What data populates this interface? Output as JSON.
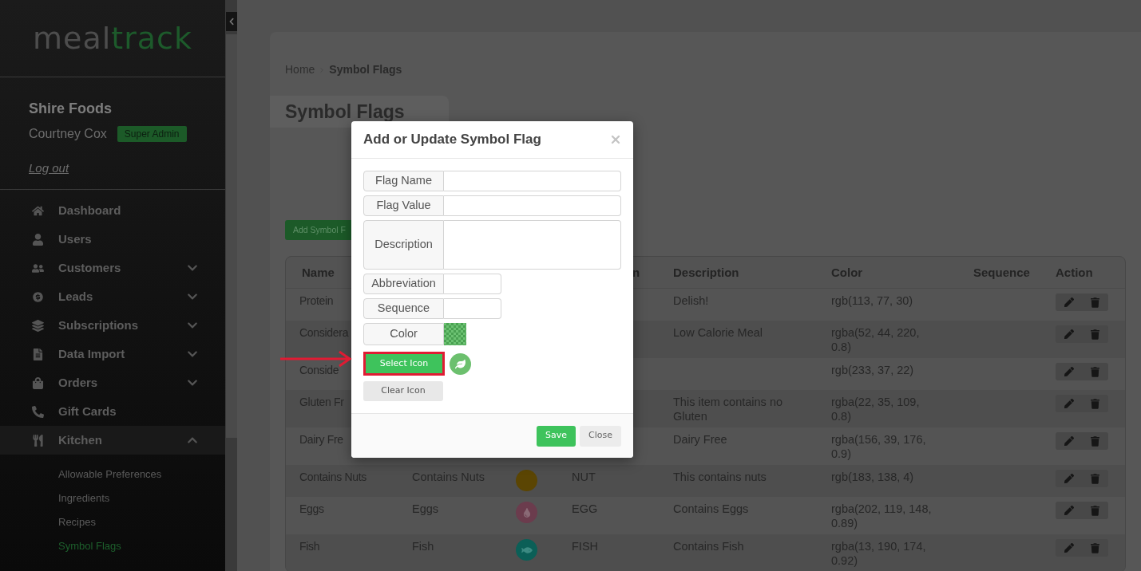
{
  "sidebar": {
    "logo": [
      {
        "text": "meal",
        "color": "#4d4d4d"
      },
      {
        "text": "track",
        "color": "#1d5a2b"
      }
    ],
    "company": "Shire Foods",
    "user": "Courtney Cox",
    "role": "Super Admin",
    "logout": "Log out",
    "items": [
      {
        "label": "Dashboard",
        "kind": "link"
      },
      {
        "label": "Users",
        "kind": "link"
      },
      {
        "label": "Customers",
        "kind": "group",
        "expanded": false
      },
      {
        "label": "Leads",
        "kind": "group",
        "expanded": false
      },
      {
        "label": "Subscriptions",
        "kind": "group",
        "expanded": false
      },
      {
        "label": "Data Import",
        "kind": "group",
        "expanded": false
      },
      {
        "label": "Orders",
        "kind": "group",
        "expanded": false
      },
      {
        "label": "Gift Cards",
        "kind": "link"
      },
      {
        "label": "Kitchen",
        "kind": "group",
        "expanded": true,
        "children": [
          {
            "label": "Allowable Preferences",
            "selected": false
          },
          {
            "label": "Ingredients",
            "selected": false
          },
          {
            "label": "Recipes",
            "selected": false
          },
          {
            "label": "Symbol Flags",
            "selected": true
          }
        ]
      }
    ]
  },
  "breadcrumb": {
    "home": "Home",
    "current": "Symbol Flags"
  },
  "title": "Symbol Flags",
  "add_button": "Add Symbol F",
  "table": {
    "columns": {
      "name": "Name",
      "column_4": "n",
      "description": "Description",
      "color_value": "Color",
      "sequence": "Sequence",
      "action": "Action"
    },
    "rows": [
      {
        "name": "Protein",
        "description": "Delish!",
        "color_value": "rgb(113, 77, 30)"
      },
      {
        "name": "Considera",
        "description": "Low Calorie Meal",
        "color_value": "rgba(52, 44, 220, 0.8)"
      },
      {
        "name": "Conside",
        "color_value": "rgb(233, 37, 22)"
      },
      {
        "name": "Gluten Fr",
        "description": "This item contains no Gluten",
        "color_value": "rgba(22, 35, 109, 0.8)"
      },
      {
        "name": "Dairy Fre",
        "description": "Dairy Free",
        "color_value": "rgba(156, 39, 176, 0.9)"
      },
      {
        "name": "Contains Nuts",
        "column_2": "Contains Nuts",
        "icon": {
          "kind": "none",
          "color": "#5b4503"
        },
        "column_4": "NUT",
        "description": "This contains nuts",
        "color_value": "rgb(183, 138, 4)"
      },
      {
        "name": "Eggs",
        "column_2": "Eggs",
        "icon": {
          "kind": "drop",
          "color": "#6b3c4d"
        },
        "column_4": "EGG",
        "description": "Contains Eggs",
        "color_value": "rgba(202, 119, 148, 0.89)"
      },
      {
        "name": "Fish",
        "column_2": "Fish",
        "icon": {
          "kind": "fish",
          "color": "#0b5f57"
        },
        "column_4": "FISH",
        "description": "Contains Fish",
        "color_value": "rgba(13, 190, 174, 0.92)"
      }
    ]
  },
  "modal": {
    "title": "Add or Update Symbol Flag",
    "fields": [
      {
        "label": "Flag Name",
        "kind": "text"
      },
      {
        "label": "Flag Value",
        "kind": "text"
      },
      {
        "label": "Description",
        "kind": "textarea"
      },
      {
        "label": "Abbreviation",
        "kind": "short"
      },
      {
        "label": "Sequence",
        "kind": "short"
      },
      {
        "label": "Color",
        "kind": "color"
      }
    ],
    "select_icon": {
      "label": "Select Icon",
      "highlighted": true
    },
    "clear_icon": "Clear Icon",
    "buttons": [
      {
        "label": "Save",
        "kind": "primary"
      },
      {
        "label": "Close",
        "kind": "secondary"
      }
    ]
  }
}
